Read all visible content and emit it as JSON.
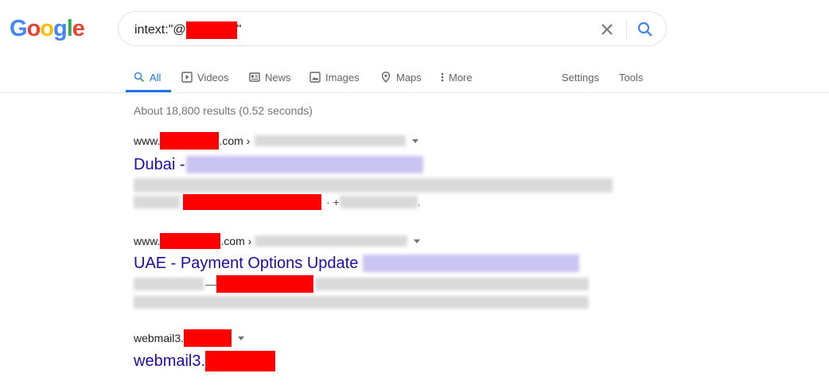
{
  "logo": {
    "letters": [
      "G",
      "o",
      "o",
      "g",
      "l",
      "e"
    ],
    "colors": [
      "#4285f4",
      "#ea4335",
      "#fbbc05",
      "#4285f4",
      "#34a853",
      "#ea4335"
    ]
  },
  "search": {
    "query_prefix": "intext:\"@",
    "query_suffix": "\"",
    "clear_icon": "close-icon",
    "search_icon": "search-icon"
  },
  "tabs": [
    {
      "label": "All",
      "icon": "search-icon",
      "active": true
    },
    {
      "label": "Videos",
      "icon": "play-icon"
    },
    {
      "label": "News",
      "icon": "newspaper-icon"
    },
    {
      "label": "Images",
      "icon": "image-icon"
    },
    {
      "label": "Maps",
      "icon": "map-pin-icon"
    },
    {
      "label": "More",
      "icon": "more-vert-icon"
    }
  ],
  "tools": {
    "settings": "Settings",
    "tools": "Tools"
  },
  "stats": "About 18,800 results (0.52 seconds)",
  "results": [
    {
      "cite_prefix": "www.",
      "cite_suffix": ".com ›",
      "title_prefix": "Dubai -",
      "snippet_sep": "· +",
      "snippet_end": "."
    },
    {
      "cite_prefix": "www.",
      "cite_suffix": ".com ›",
      "title_prefix": "UAE - Payment Options Update",
      "snippet_sep": "—"
    },
    {
      "cite_prefix": "webmail3.",
      "title_prefix": "webmail3."
    }
  ],
  "colors": {
    "accent": "#1a73e8",
    "link": "#1a0dab",
    "redaction": "#ff0000"
  }
}
